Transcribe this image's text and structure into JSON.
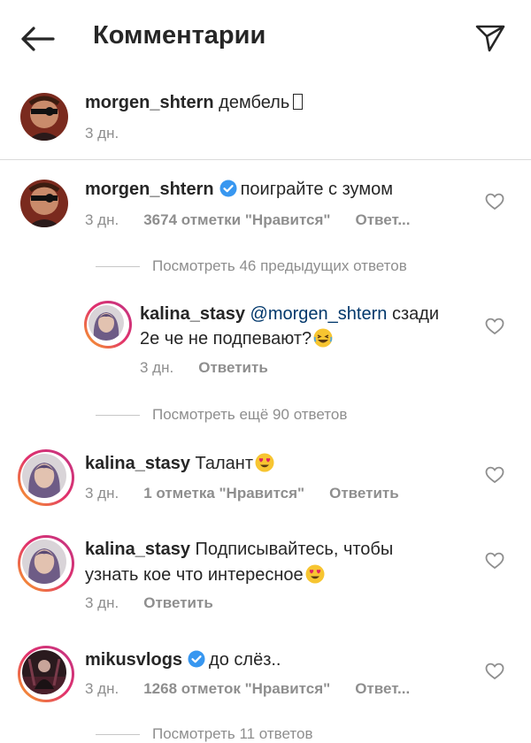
{
  "header": {
    "title": "Комментарии"
  },
  "caption": {
    "username": "morgen_shtern",
    "text": "дембель",
    "time": "3 дн."
  },
  "comments": [
    {
      "username": "morgen_shtern",
      "text": "поиграйте с зумом",
      "time": "3 дн.",
      "likes": "3674 отметки \"Нравится\"",
      "reply": "Ответ..."
    },
    {
      "username": "kalina_stasy",
      "text": "Талант",
      "time": "3 дн.",
      "likes": "1 отметка \"Нравится\"",
      "reply": "Ответить"
    },
    {
      "username": "kalina_stasy",
      "text_line1": "Подписывайтесь, чтобы",
      "text_line2": "узнать кое что интересное",
      "time": "3 дн.",
      "reply": "Ответить"
    },
    {
      "username": "mikusvlogs",
      "text": "до слёз..",
      "time": "3 дн.",
      "likes": "1268 отметок \"Нравится\"",
      "reply": "Ответ..."
    }
  ],
  "replies_view_prev": "Посмотреть 46 предыдущих ответов",
  "reply": {
    "username": "kalina_stasy",
    "mention": "@morgen_shtern",
    "text_line1": "сзади",
    "text_line2": "2е че не подпевают?",
    "time": "3 дн.",
    "reply_label": "Ответить"
  },
  "replies_view_more": "Посмотреть ещё 90 ответов",
  "replies_view_bottom": "Посмотреть 11 ответов",
  "colors": {
    "verified": "#3897f0",
    "meta": "#8e8e8e",
    "text": "#262626"
  },
  "icons": [
    "back-arrow-icon",
    "direct-send-icon",
    "verified-badge-icon",
    "heart-outline-icon",
    "laughing-emoji-icon",
    "heart-eyes-emoji-icon"
  ]
}
